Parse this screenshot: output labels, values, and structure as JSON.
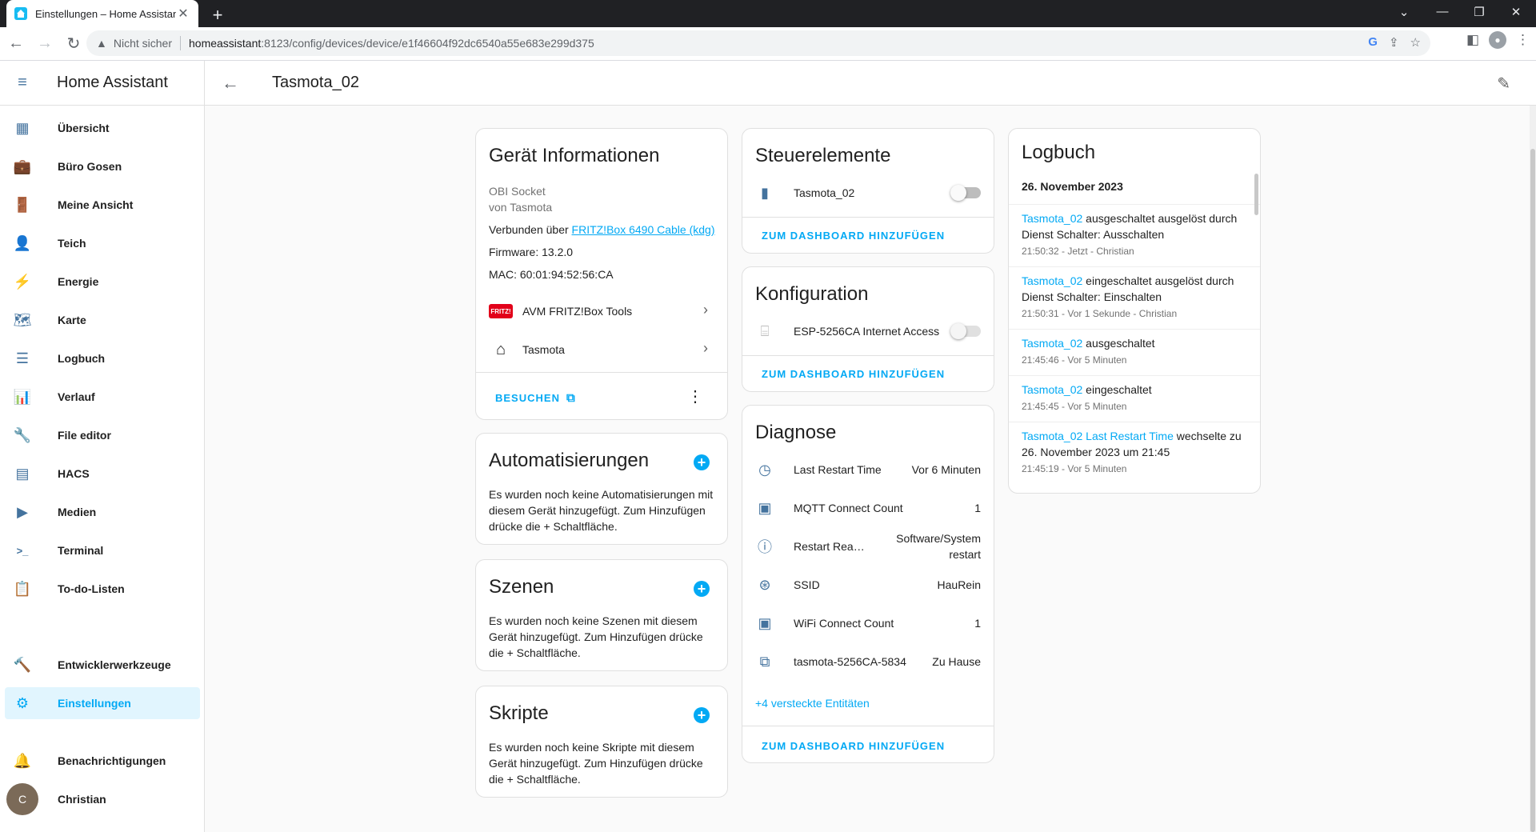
{
  "browser": {
    "tab_title": "Einstellungen – Home Assistant",
    "tab_close": "✕",
    "new_tab": "+",
    "not_secure": "Nicht sicher",
    "url_host": "homeassistant",
    "url_path": ":8123/config/devices/device/e1f46604f92dc6540a55e683e299d375",
    "window_controls": [
      "⌄",
      "—",
      "❐",
      "✕"
    ]
  },
  "sidebar": {
    "title": "Home Assistant",
    "items": [
      {
        "label": "Übersicht",
        "icon": "dashboard-icon",
        "glyph": "▦"
      },
      {
        "label": "Büro Gosen",
        "icon": "briefcase-icon",
        "glyph": "💼"
      },
      {
        "label": "Meine Ansicht",
        "icon": "door-icon",
        "glyph": "🚪"
      },
      {
        "label": "Teich",
        "icon": "account-icon",
        "glyph": "👤"
      },
      {
        "label": "Energie",
        "icon": "lightning-icon",
        "glyph": "⚡"
      },
      {
        "label": "Karte",
        "icon": "map-icon",
        "glyph": "🗺"
      },
      {
        "label": "Logbuch",
        "icon": "list-icon",
        "glyph": "☰"
      },
      {
        "label": "Verlauf",
        "icon": "chart-icon",
        "glyph": "📊"
      },
      {
        "label": "File editor",
        "icon": "wrench-icon",
        "glyph": "🔧"
      },
      {
        "label": "HACS",
        "icon": "hacs-icon",
        "glyph": "▤"
      },
      {
        "label": "Medien",
        "icon": "play-icon",
        "glyph": "▶"
      },
      {
        "label": "Terminal",
        "icon": "terminal-icon",
        "glyph": ">_"
      },
      {
        "label": "To-do-Listen",
        "icon": "clipboard-icon",
        "glyph": "📋"
      }
    ],
    "dev_tools": "Entwicklerwerkzeuge",
    "settings": "Einstellungen",
    "notifications": "Benachrichtigungen",
    "user": "Christian"
  },
  "header": {
    "title": "Tasmota_02"
  },
  "device_info": {
    "title": "Gerät Informationen",
    "model": "OBI Socket",
    "manufacturer": "von Tasmota",
    "connected_prefix": "Verbunden über ",
    "connected_link": "FRITZ!Box 6490 Cable (kdg)",
    "firmware": "Firmware: 13.2.0",
    "mac": "MAC: 60:01:94:52:56:CA",
    "integrations": [
      "AVM FRITZ!Box Tools",
      "Tasmota"
    ],
    "visit": "BESUCHEN"
  },
  "automations": {
    "title": "Automatisierungen",
    "text": "Es wurden noch keine Automatisierungen mit diesem Gerät hinzugefügt. Zum Hinzufügen drücke die + Schaltfläche."
  },
  "scenes": {
    "title": "Szenen",
    "text": "Es wurden noch keine Szenen mit diesem Gerät hinzugefügt. Zum Hinzufügen drücke die + Schaltfläche."
  },
  "scripts": {
    "title": "Skripte",
    "text": "Es wurden noch keine Skripte mit diesem Gerät hinzugefügt. Zum Hinzufügen drücke die + Schaltfläche."
  },
  "controls": {
    "title": "Steuerelemente",
    "entity": "Tasmota_02",
    "add_dashboard": "ZUM DASHBOARD HINZUFÜGEN"
  },
  "config": {
    "title": "Konfiguration",
    "entity": "ESP-5256CA Internet Access",
    "add_dashboard": "ZUM DASHBOARD HINZUFÜGEN"
  },
  "diagnostics": {
    "title": "Diagnose",
    "rows": [
      {
        "name": "Last Restart Time",
        "value": "Vor 6 Minuten"
      },
      {
        "name": "MQTT Connect Count",
        "value": "1"
      },
      {
        "name": "Restart Rea…",
        "value": "Software/System restart"
      },
      {
        "name": "SSID",
        "value": "HauRein"
      },
      {
        "name": "WiFi Connect Count",
        "value": "1"
      },
      {
        "name": "tasmota-5256CA-5834",
        "value": "Zu Hause"
      }
    ],
    "hidden": "+4 versteckte Entitäten",
    "add_dashboard": "ZUM DASHBOARD HINZUFÜGEN"
  },
  "logbook": {
    "title": "Logbuch",
    "date": "26. November 2023",
    "entries": [
      {
        "entity": "Tasmota_02",
        "text": " ausgeschaltet ausgelöst durch Dienst Schalter: Ausschalten",
        "time": "21:50:32 - Jetzt - Christian"
      },
      {
        "entity": "Tasmota_02",
        "text": " eingeschaltet ausgelöst durch Dienst Schalter: Einschalten",
        "time": "21:50:31 - Vor 1 Sekunde - Christian"
      },
      {
        "entity": "Tasmota_02",
        "text": " ausgeschaltet",
        "time": "21:45:46 - Vor 5 Minuten"
      },
      {
        "entity": "Tasmota_02",
        "text": " eingeschaltet",
        "time": "21:45:45 - Vor 5 Minuten"
      },
      {
        "entity": "Tasmota_02 Last Restart Time",
        "text": " wechselte zu 26. November 2023 um 21:45",
        "time": "21:45:19 - Vor 5 Minuten"
      }
    ]
  },
  "colors": {
    "accent": "#03a9f4",
    "icon": "#44739e",
    "active_bg": "#e1f5fe"
  }
}
